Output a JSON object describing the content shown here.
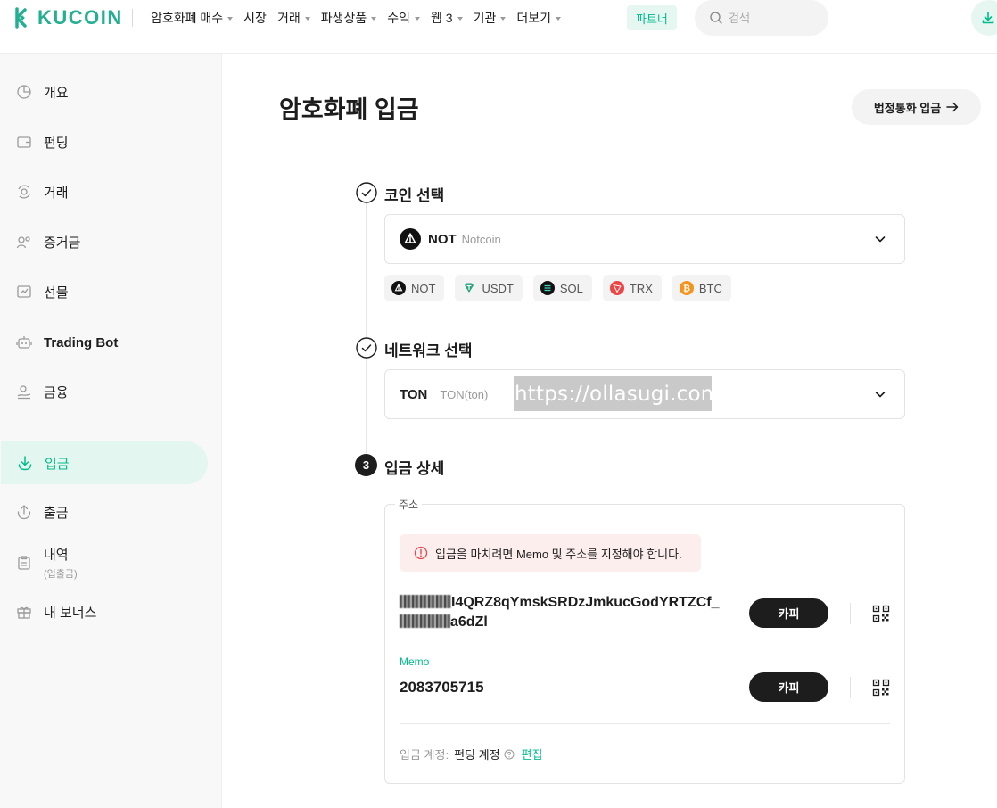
{
  "brand": {
    "name": "KUCOIN",
    "accent": "#01bc8d"
  },
  "nav": {
    "items": [
      {
        "label": "암호화폐 매수",
        "caret": true
      },
      {
        "label": "시장",
        "caret": false
      },
      {
        "label": "거래",
        "caret": true
      },
      {
        "label": "파생상품",
        "caret": true
      },
      {
        "label": "수익",
        "caret": true
      },
      {
        "label": "웹 3",
        "caret": true
      },
      {
        "label": "기관",
        "caret": true
      },
      {
        "label": "더보기",
        "caret": true
      }
    ],
    "partner": "파트너",
    "search_placeholder": "검색"
  },
  "sidebar": {
    "items": [
      {
        "label": "개요",
        "icon": "pie-chart-icon"
      },
      {
        "label": "펀딩",
        "icon": "wallet-icon"
      },
      {
        "label": "거래",
        "icon": "trade-icon"
      },
      {
        "label": "증거금",
        "icon": "margin-icon"
      },
      {
        "label": "선물",
        "icon": "futures-icon"
      },
      {
        "label": "Trading Bot",
        "icon": "robot-icon"
      },
      {
        "label": "금융",
        "icon": "finance-icon"
      },
      {
        "label": "입금",
        "icon": "deposit-icon",
        "active": true
      },
      {
        "label": "출금",
        "icon": "withdraw-icon"
      },
      {
        "label": "내역",
        "sub": "(입출금)",
        "icon": "history-icon"
      },
      {
        "label": "내 보너스",
        "icon": "gift-icon"
      }
    ]
  },
  "main": {
    "title": "암호화폐 입금",
    "fiat_button": "법정통화 입금",
    "step1": {
      "title": "코인 선택",
      "selected_symbol": "NOT",
      "selected_name": "Notcoin",
      "quick_coins": [
        "NOT",
        "USDT",
        "SOL",
        "TRX",
        "BTC"
      ]
    },
    "step2": {
      "title": "네트워크 선택",
      "network": "TON",
      "network_sub": "TON(ton)",
      "watermark": "https://ollasugi.com"
    },
    "step3": {
      "number": "3",
      "title": "입금 상세",
      "address_legend": "주소",
      "warning": "입금을 마치려면 Memo 및 주소를 지정해야 합니다.",
      "address_line1": "I4QRZ8qYmskSRDzJmkucGodYRTZCf_",
      "address_line2": "a6dZl",
      "copy_label": "카피",
      "memo_label": "Memo",
      "memo_value": "2083705715",
      "account_label": "입금 계정:",
      "account_value": "펀딩 계정",
      "edit_label": "편집"
    }
  }
}
